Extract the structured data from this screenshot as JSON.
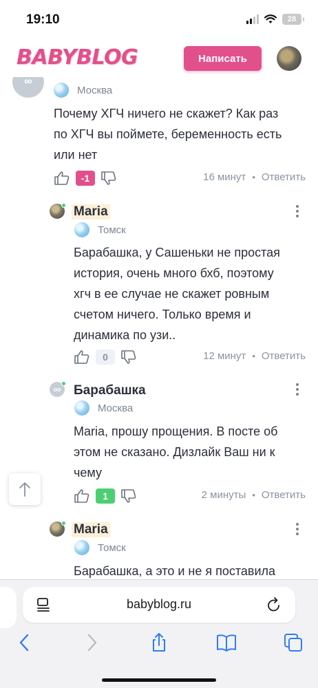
{
  "status_bar": {
    "time": "19:10",
    "battery": "28"
  },
  "header": {
    "logo": "BABYBLOG",
    "write_button": "Написать"
  },
  "comments": [
    {
      "city": "Москва",
      "text_lines": [
        "Почему ХГЧ ничего не скажет? Как раз",
        "по ХГЧ вы поймете, беременность есть",
        "или нет"
      ],
      "score": "-1",
      "time": "16 минут",
      "reply": "Ответить"
    },
    {
      "author": "Maria",
      "city": "Томск",
      "text_lines": [
        "Барабашка, у Сашеньки не простая",
        "история, очень много бхб, поэтому",
        "хгч в ее случае не скажет ровным",
        "счетом ничего. Только время и",
        "динамика по узи.."
      ],
      "score": "0",
      "time": "12 минут",
      "reply": "Ответить"
    },
    {
      "author": "Барабашка",
      "avatar_text": "oo",
      "city": "Москва",
      "text_lines": [
        "Maria, прошу прощения. В посте об",
        "этом не сказано. Дизлайк Ваш ни к",
        "чему"
      ],
      "score": "1",
      "time": "2 минуты",
      "reply": "Ответить"
    },
    {
      "author": "Maria",
      "city": "Томск",
      "text_lines": [
        "Барабашка, а это и не я поставила"
      ]
    }
  ],
  "browser": {
    "url": "babyblog.ru"
  },
  "colors": {
    "brand": "#e2508b",
    "positive": "#4ccf73",
    "link": "#8a93a0",
    "ios_blue": "#2f7cf6"
  }
}
